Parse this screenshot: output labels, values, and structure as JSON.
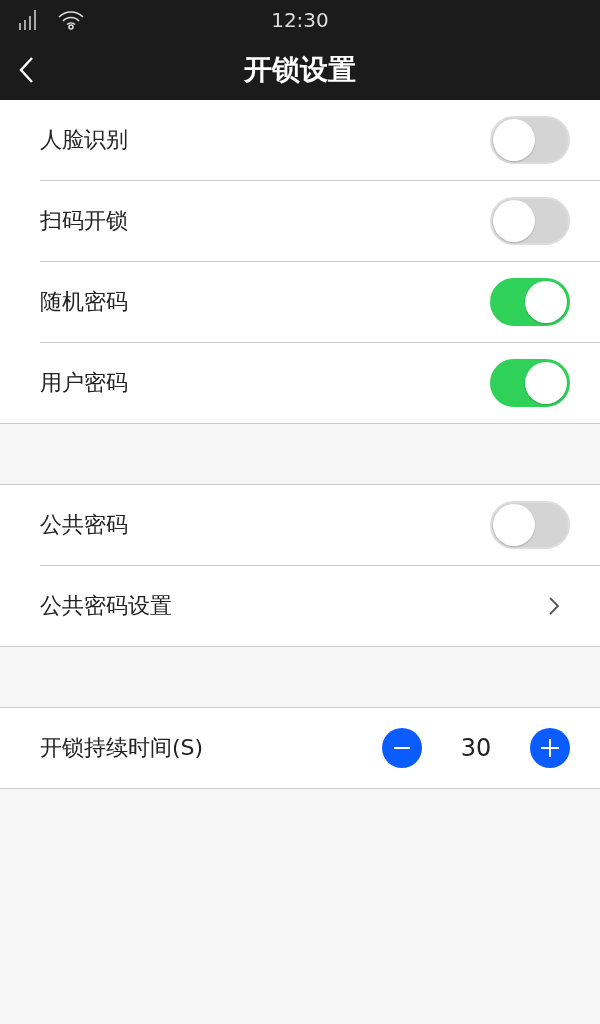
{
  "status_bar": {
    "time": "12:30"
  },
  "nav": {
    "title": "开锁设置"
  },
  "groups": [
    {
      "rows": [
        {
          "kind": "toggle",
          "label": "人脸识别",
          "on": false
        },
        {
          "kind": "toggle",
          "label": "扫码开锁",
          "on": false
        },
        {
          "kind": "toggle",
          "label": "随机密码",
          "on": true
        },
        {
          "kind": "toggle",
          "label": "用户密码",
          "on": true
        }
      ]
    },
    {
      "rows": [
        {
          "kind": "toggle",
          "label": "公共密码",
          "on": false
        },
        {
          "kind": "link",
          "label": "公共密码设置"
        }
      ]
    },
    {
      "rows": [
        {
          "kind": "stepper",
          "label": "开锁持续时间(S)",
          "value": "30"
        }
      ]
    }
  ]
}
